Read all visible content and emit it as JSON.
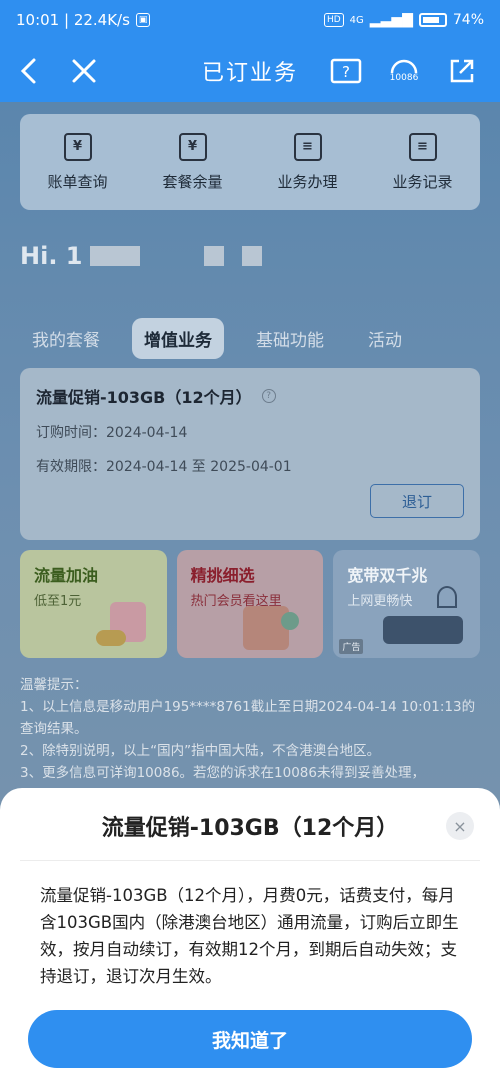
{
  "status_bar": {
    "time_speed": "10:01 | 22.4K/s",
    "hd": "HD",
    "network": "4G",
    "battery": "74%"
  },
  "nav": {
    "title": "已订业务",
    "service_label": "10086"
  },
  "quick_actions": [
    {
      "label": "账单查询",
      "icon": "bill-search-icon"
    },
    {
      "label": "套餐余量",
      "icon": "calendar-icon"
    },
    {
      "label": "业务办理",
      "icon": "clipboard-icon"
    },
    {
      "label": "业务记录",
      "icon": "document-icon"
    }
  ],
  "greeting": {
    "text": "Hi. 1"
  },
  "tabs": [
    {
      "label": "我的套餐",
      "active": false
    },
    {
      "label": "增值业务",
      "active": true
    },
    {
      "label": "基础功能",
      "active": false
    },
    {
      "label": "活动",
      "active": false
    }
  ],
  "package": {
    "title": "流量促销-103GB（12个月）",
    "order_time": "订购时间：2024-04-14",
    "validity": "有效期限：2024-04-14 至 2025-04-01",
    "unsubscribe_label": "退订"
  },
  "promos": [
    {
      "title": "流量加油",
      "subtitle": "低至1元"
    },
    {
      "title": "精挑细选",
      "subtitle": "热门会员看这里"
    },
    {
      "title": "宽带双千兆",
      "subtitle": "上网更畅快",
      "badge": "广告"
    }
  ],
  "tips": {
    "heading": "温馨提示：",
    "line1": "1、以上信息是移动用户195****8761截止至日期2024-04-14 10:01:13的查询结果。",
    "line2": "2、除特别说明，以上“国内”指中国大陆，不含港澳台地区。",
    "line3": "3、更多信息可详询10086。若您的诉求在10086未得到妥善处理，"
  },
  "sheet": {
    "title": "流量促销-103GB（12个月）",
    "close": "×",
    "body": "流量促销-103GB（12个月），月费0元，话费支付，每月含103GB国内（除港澳台地区）通用流量，订购后立即生效，按月自动续订，有效期12个月，到期后自动失效；支持退订，退订次月生效。",
    "confirm_label": "我知道了"
  },
  "colors": {
    "primary": "#2f8ff0"
  }
}
